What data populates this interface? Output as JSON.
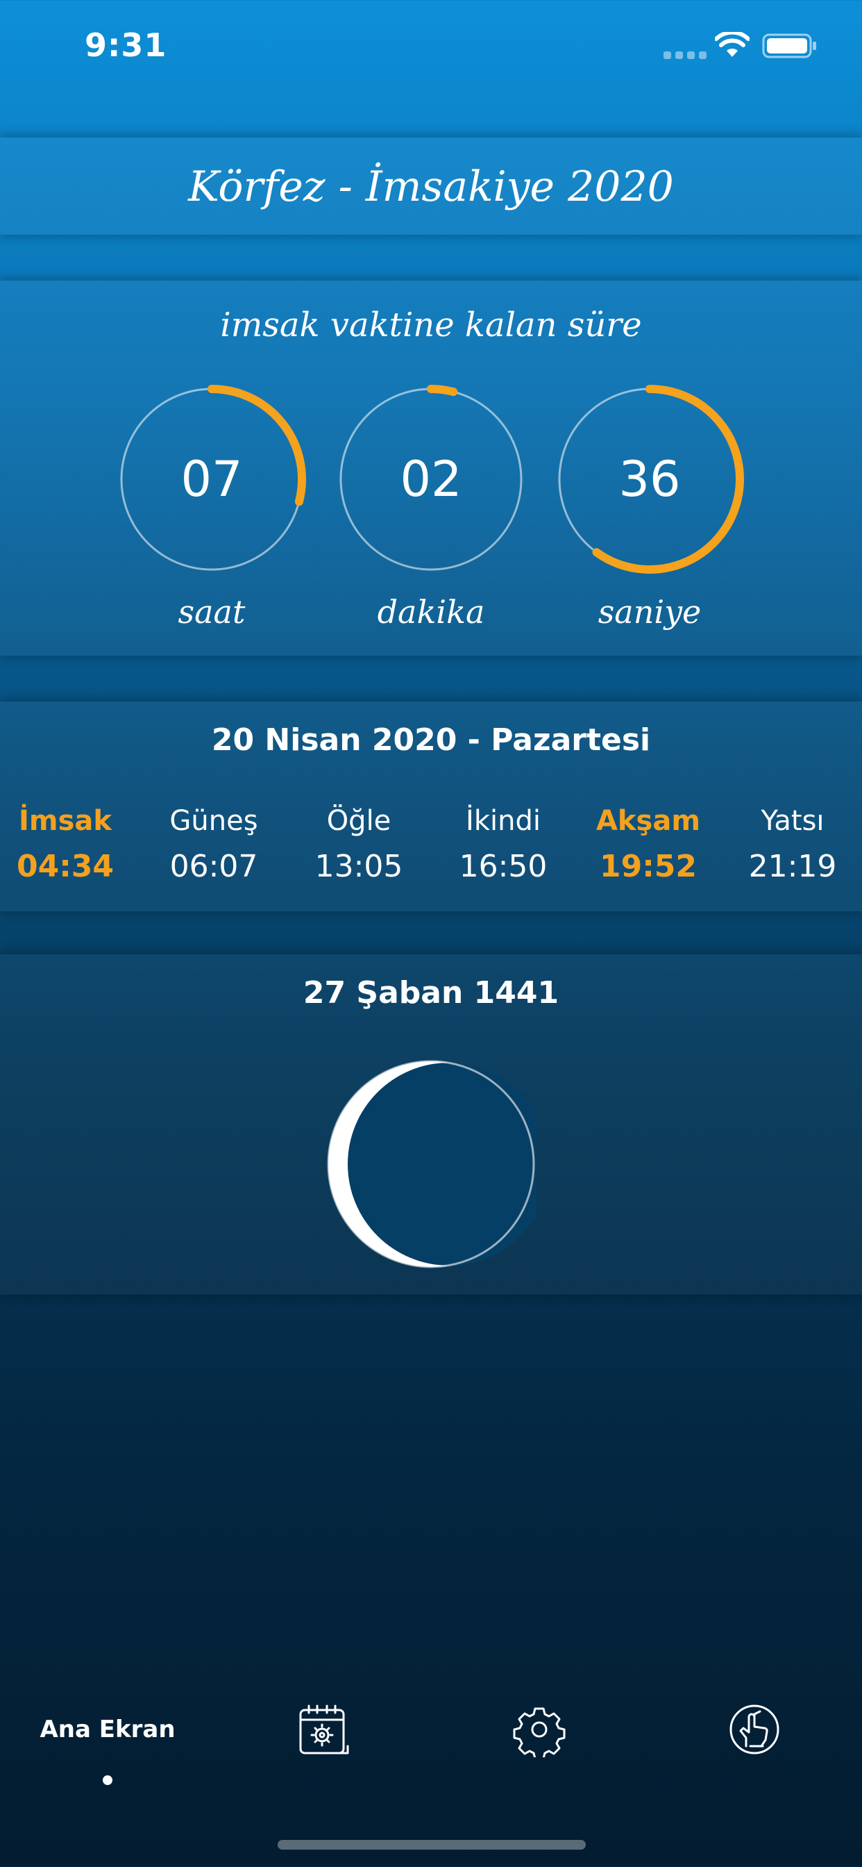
{
  "status_bar": {
    "time": "9:31"
  },
  "header": {
    "title": "Körfez - İmsakiye 2020"
  },
  "countdown": {
    "title": "imsak vaktine kalan süre",
    "accent_color": "#f5a21d",
    "units": [
      {
        "value": "07",
        "label": "saat",
        "progress": 0.29
      },
      {
        "value": "02",
        "label": "dakika",
        "progress": 0.04
      },
      {
        "value": "36",
        "label": "saniye",
        "progress": 0.6
      }
    ]
  },
  "prayer_times": {
    "date": "20 Nisan 2020 - Pazartesi",
    "highlight_color": "#f4a11e",
    "items": [
      {
        "name": "İmsak",
        "time": "04:34",
        "highlighted": true
      },
      {
        "name": "Güneş",
        "time": "06:07",
        "highlighted": false
      },
      {
        "name": "Öğle",
        "time": "13:05",
        "highlighted": false
      },
      {
        "name": "İkindi",
        "time": "16:50",
        "highlighted": false
      },
      {
        "name": "Akşam",
        "time": "19:52",
        "highlighted": true
      },
      {
        "name": "Yatsı",
        "time": "21:19",
        "highlighted": false
      }
    ]
  },
  "hijri": {
    "date": "27 Şaban 1441"
  },
  "tab_bar": {
    "tabs": [
      {
        "label": "Ana Ekran",
        "icon": "home-label",
        "active": true
      },
      {
        "label": "",
        "icon": "calendar-gear-icon",
        "active": false
      },
      {
        "label": "",
        "icon": "gear-icon",
        "active": false
      },
      {
        "label": "",
        "icon": "hand-prayer-icon",
        "active": false
      }
    ]
  }
}
